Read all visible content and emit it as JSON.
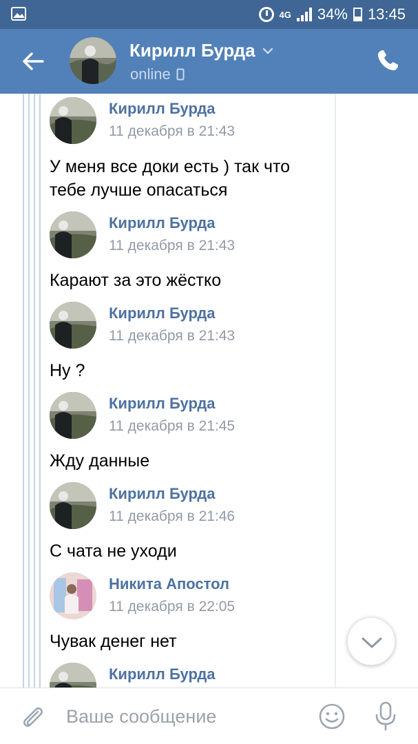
{
  "statusbar": {
    "network": "4G",
    "battery": "34%",
    "time": "13:45"
  },
  "header": {
    "contact_name": "Кирилл Бурда",
    "status": "online"
  },
  "messages": [
    {
      "author": "Кирилл Бурда",
      "time": "11 декабря в 21:43",
      "text": "У меня все доки есть ) так что тебе лучше опасаться"
    },
    {
      "author": "Кирилл Бурда",
      "time": "11 декабря в 21:43",
      "text": "Карают за это жёстко"
    },
    {
      "author": "Кирилл Бурда",
      "time": "11 декабря в 21:43",
      "text": "Ну ?"
    },
    {
      "author": "Кирилл Бурда",
      "time": "11 декабря в 21:45",
      "text": "Жду данные"
    },
    {
      "author": "Кирилл Бурда",
      "time": "11 декабря в 21:46",
      "text": "С чата не уходи"
    },
    {
      "author": "Никита Апостол",
      "time": "11 декабря в 22:05",
      "text": "Чувак денег нет"
    },
    {
      "author": "Кирилл Бурда",
      "time": "",
      "text": ""
    }
  ],
  "composer": {
    "placeholder": "Ваше сообщение"
  },
  "colors": {
    "statusbar": "#3f6694",
    "header": "#5181b8",
    "author_name": "#4d72a1",
    "timestamp": "#929aa5"
  }
}
